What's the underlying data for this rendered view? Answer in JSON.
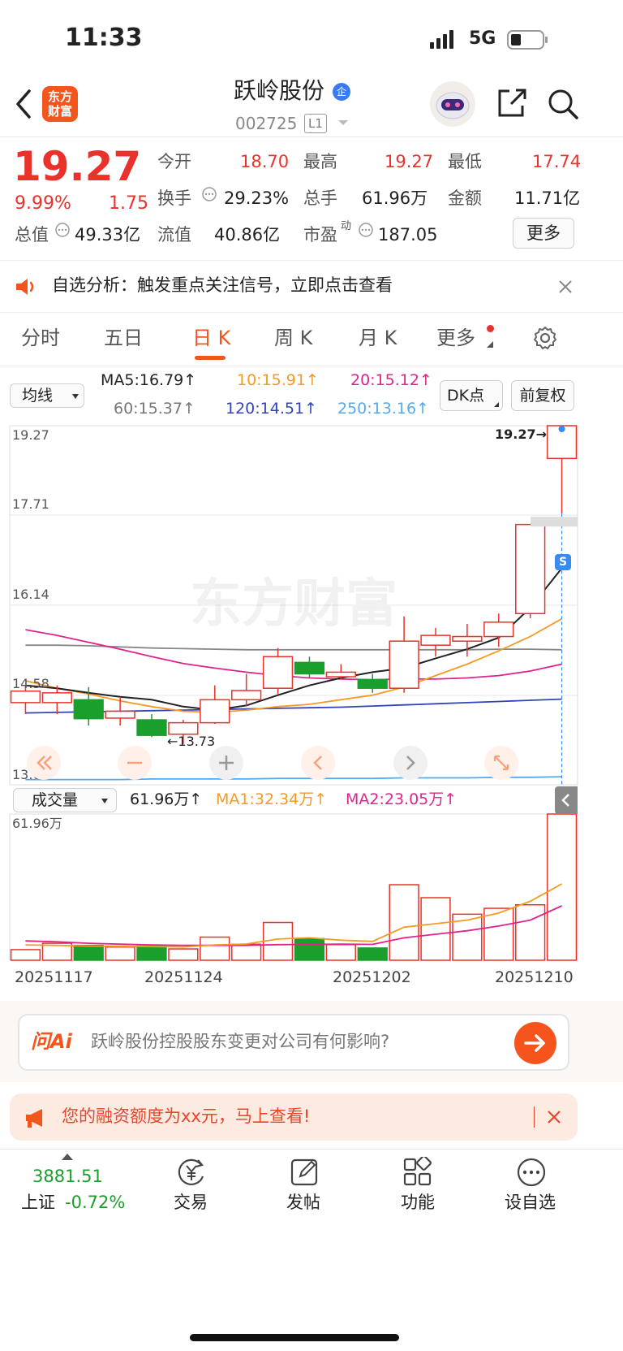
{
  "status_bar": {
    "time": "11:33",
    "network": "5G"
  },
  "header": {
    "logo_text": "东方财富",
    "stock_name": "跃岭股份",
    "enterprise_badge": "企",
    "stock_code": "002725",
    "level_badge": "L1"
  },
  "quote": {
    "price": "19.27",
    "change_pct": "9.99%",
    "change_amt": "1.75",
    "stats": [
      {
        "label": "今开",
        "value": "18.70",
        "color": "red"
      },
      {
        "label": "最高",
        "value": "19.27",
        "color": "red"
      },
      {
        "label": "最低",
        "value": "17.74",
        "color": "red"
      },
      {
        "label": "换手",
        "value": "29.23%",
        "color": "dark"
      },
      {
        "label": "总手",
        "value": "61.96万",
        "color": "dark"
      },
      {
        "label": "金额",
        "value": "11.71亿",
        "color": "dark"
      },
      {
        "label": "总值",
        "value": "49.33亿",
        "color": "dark"
      },
      {
        "label": "流值",
        "value": "40.86亿",
        "color": "dark"
      },
      {
        "label": "市盈",
        "value": "187.05",
        "color": "dark",
        "sup": "动"
      }
    ],
    "more_label": "更多"
  },
  "notice": {
    "text": "自选分析：触发重点关注信号，立即点击查看"
  },
  "tabs": [
    {
      "label": "分时",
      "active": false
    },
    {
      "label": "五日",
      "active": false
    },
    {
      "label": "日 K",
      "active": true
    },
    {
      "label": "周 K",
      "active": false
    },
    {
      "label": "月 K",
      "active": false
    },
    {
      "label": "更多",
      "active": false
    }
  ],
  "ma_bar": {
    "selector": "均线",
    "ma5": "MA5:16.79",
    "ma10": "10:15.91",
    "ma20": "20:15.12",
    "ma60": "60:15.37",
    "ma120": "120:14.51",
    "ma250": "250:13.16",
    "dk_label": "DK点",
    "fq_label": "前复权"
  },
  "colors": {
    "up": "#e8322b",
    "down": "#1a9e2c",
    "ma5": "#222222",
    "ma10": "#f59a23",
    "ma20": "#e0248a",
    "ma60": "#888888",
    "ma120": "#3344bb",
    "ma250": "#55aaee",
    "accent": "#ff5a1f"
  },
  "chart_data": [
    {
      "type": "candlestick",
      "y_ticks": [
        "19.27",
        "17.71",
        "16.14",
        "14.58",
        "13.02"
      ],
      "ylim": [
        13.02,
        19.27
      ],
      "watermark": "东方财富",
      "last_price_label": "19.27",
      "low_marker_label": "13.73",
      "s_marker": "S",
      "candles": [
        {
          "open": 14.45,
          "high": 14.75,
          "low": 14.25,
          "close": 14.65
        },
        {
          "open": 14.45,
          "high": 14.75,
          "low": 14.25,
          "close": 14.62
        },
        {
          "open": 14.5,
          "high": 14.72,
          "low": 14.05,
          "close": 14.17
        },
        {
          "open": 14.18,
          "high": 14.55,
          "low": 14.05,
          "close": 14.3
        },
        {
          "open": 14.15,
          "high": 14.25,
          "low": 13.85,
          "close": 13.88
        },
        {
          "open": 13.9,
          "high": 14.15,
          "low": 13.73,
          "close": 14.1
        },
        {
          "open": 14.1,
          "high": 14.75,
          "low": 14.08,
          "close": 14.5
        },
        {
          "open": 14.5,
          "high": 14.95,
          "low": 14.38,
          "close": 14.66
        },
        {
          "open": 14.7,
          "high": 15.4,
          "low": 14.6,
          "close": 15.25
        },
        {
          "open": 15.15,
          "high": 15.25,
          "low": 14.88,
          "close": 14.95
        },
        {
          "open": 14.9,
          "high": 15.12,
          "low": 14.85,
          "close": 14.98
        },
        {
          "open": 14.85,
          "high": 14.95,
          "low": 14.62,
          "close": 14.7
        },
        {
          "open": 14.7,
          "high": 15.95,
          "low": 14.62,
          "close": 15.52
        },
        {
          "open": 15.45,
          "high": 15.75,
          "low": 15.25,
          "close": 15.62
        },
        {
          "open": 15.52,
          "high": 15.82,
          "low": 15.25,
          "close": 15.6
        },
        {
          "open": 15.6,
          "high": 16.0,
          "low": 15.42,
          "close": 15.85
        },
        {
          "open": 16.0,
          "high": 17.55,
          "low": 15.92,
          "close": 17.55
        },
        {
          "open": 18.7,
          "high": 19.27,
          "low": 17.74,
          "close": 19.27
        }
      ],
      "ma5": [
        14.75,
        14.7,
        14.62,
        14.55,
        14.5,
        14.38,
        14.32,
        14.4,
        14.58,
        14.75,
        14.88,
        14.98,
        15.05,
        15.22,
        15.38,
        15.58,
        16.1,
        16.79
      ],
      "ma10": [
        14.83,
        14.7,
        14.6,
        14.48,
        14.38,
        14.3,
        14.28,
        14.32,
        14.38,
        14.42,
        14.5,
        14.58,
        14.72,
        14.92,
        15.12,
        15.35,
        15.6,
        15.91
      ],
      "ma20": [
        15.72,
        15.62,
        15.5,
        15.38,
        15.25,
        15.13,
        15.05,
        14.98,
        14.92,
        14.88,
        14.86,
        14.85,
        14.86,
        14.86,
        14.88,
        14.92,
        15.0,
        15.12
      ],
      "ma60": [
        15.45,
        15.45,
        15.44,
        15.42,
        15.4,
        15.39,
        15.38,
        15.37,
        15.37,
        15.37,
        15.37,
        15.37,
        15.37,
        15.37,
        15.37,
        15.38,
        15.38,
        15.37
      ],
      "ma120": [
        14.27,
        14.28,
        14.29,
        14.3,
        14.31,
        14.32,
        14.33,
        14.34,
        14.35,
        14.36,
        14.37,
        14.39,
        14.41,
        14.43,
        14.45,
        14.47,
        14.49,
        14.51
      ],
      "ma250": [
        13.11,
        13.11,
        13.11,
        13.11,
        13.12,
        13.12,
        13.12,
        13.12,
        13.13,
        13.13,
        13.13,
        13.13,
        13.14,
        13.14,
        13.14,
        13.15,
        13.15,
        13.16
      ]
    },
    {
      "type": "bar",
      "selector": "成交量",
      "value_label": "61.96万",
      "ma1_label": "MA1:32.34万",
      "ma2_label": "MA2:23.05万",
      "y_max_label": "61.96万",
      "ylim": [
        0,
        61.96
      ],
      "x_labels": [
        "20251117",
        "20251124",
        "20251202",
        "20251210"
      ],
      "volumes": [
        4.5,
        7.2,
        6.3,
        5.6,
        6.0,
        4.8,
        9.8,
        6.8,
        16.0,
        9.2,
        6.6,
        5.2,
        32.0,
        26.5,
        19.5,
        22.0,
        23.5,
        61.96
      ],
      "ma1": [
        6.5,
        6.3,
        6.0,
        5.9,
        5.8,
        5.6,
        6.5,
        6.9,
        9.0,
        9.5,
        8.5,
        8.0,
        14.0,
        15.5,
        17.0,
        20.0,
        25.0,
        32.34
      ],
      "ma2": [
        8.2,
        7.8,
        7.2,
        6.8,
        6.5,
        6.3,
        6.3,
        6.3,
        6.6,
        6.7,
        6.8,
        6.7,
        9.5,
        11.0,
        12.5,
        14.5,
        17.0,
        23.05
      ]
    }
  ],
  "ai_box": {
    "logo": "问Ai",
    "text": "跃岭股份控股股东变更对公司有何影响?"
  },
  "promo": {
    "text": "您的融资额度为xx元，马上查看!"
  },
  "bottom_nav": {
    "index_value": "3881.51",
    "index_label": "上证",
    "index_change": "-0.72%",
    "items": [
      {
        "label": "交易",
        "icon": "yen-cycle-icon"
      },
      {
        "label": "发帖",
        "icon": "edit-icon"
      },
      {
        "label": "功能",
        "icon": "grid-icon"
      },
      {
        "label": "设自选",
        "icon": "more-dots-icon"
      }
    ]
  }
}
